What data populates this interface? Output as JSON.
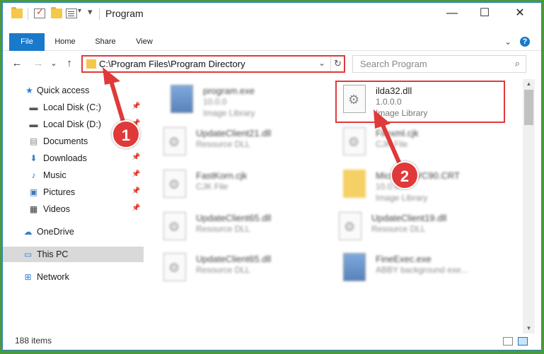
{
  "window": {
    "title": "Program",
    "controls": {
      "minimize": "—",
      "maximize": "☐",
      "close": "✕"
    }
  },
  "ribbon": {
    "tabs": [
      {
        "label": "File"
      },
      {
        "label": "Home"
      },
      {
        "label": "Share"
      },
      {
        "label": "View"
      }
    ],
    "collapse_icon": "chevron-down-icon",
    "help_icon": "help-icon",
    "help_glyph": "?"
  },
  "nav": {
    "back_glyph": "←",
    "forward_glyph": "→",
    "recent_glyph": "⌄",
    "up_glyph": "↑"
  },
  "address": {
    "path": "C:\\Program Files\\Program Directory",
    "dropdown_glyph": "⌄",
    "refresh_glyph": "↻"
  },
  "search": {
    "placeholder": "Search Program",
    "icon_glyph": "⌕"
  },
  "sidebar": {
    "items": [
      {
        "label": "Quick access",
        "icon": "star-icon"
      },
      {
        "label": "Local Disk (C:)",
        "icon": "drive-icon",
        "pinned": true
      },
      {
        "label": "Local Disk (D:)",
        "icon": "drive-icon",
        "pinned": true
      },
      {
        "label": "Documents",
        "icon": "documents-icon",
        "pinned": true
      },
      {
        "label": "Downloads",
        "icon": "download-icon",
        "pinned": true
      },
      {
        "label": "Music",
        "icon": "music-icon",
        "pinned": true
      },
      {
        "label": "Pictures",
        "icon": "pictures-icon",
        "pinned": true
      },
      {
        "label": "Videos",
        "icon": "videos-icon",
        "pinned": true
      },
      {
        "label": "OneDrive",
        "icon": "cloud-icon"
      },
      {
        "label": "This PC",
        "icon": "computer-icon",
        "selected": true
      },
      {
        "label": "Network",
        "icon": "network-icon"
      }
    ]
  },
  "files": [
    {
      "name": "program.exe",
      "meta1": "10.0.0",
      "meta2": "Image Library"
    },
    {
      "name": "ilda32.dll",
      "meta1": "1.0.0.0",
      "meta2": "Image Library"
    },
    {
      "name": "UpdateClient21.dll",
      "meta1": "Resource DLL"
    },
    {
      "name": "Filexml.cjk",
      "meta1": "CJK File"
    },
    {
      "name": "FastKorn.cjk",
      "meta1": "CJK File"
    },
    {
      "name": "Microsoft.VC90.CRT",
      "meta1": "10.0.0",
      "meta2": "Image Library"
    },
    {
      "name": "UpdateClient65.dll",
      "meta1": "Resource DLL"
    },
    {
      "name": "UpdateClient19.dll",
      "meta1": "Resource DLL"
    },
    {
      "name": "UpdateClient65.dll",
      "meta1": "Resource DLL"
    },
    {
      "name": "FineExec.exe",
      "meta1": "ABBY background exe..."
    }
  ],
  "status": {
    "item_count": "188 items"
  },
  "callouts": [
    {
      "number": "1"
    },
    {
      "number": "2"
    }
  ],
  "colors": {
    "accent": "#1979ca",
    "highlight": "#e0393a",
    "folder": "#f4c84a"
  }
}
